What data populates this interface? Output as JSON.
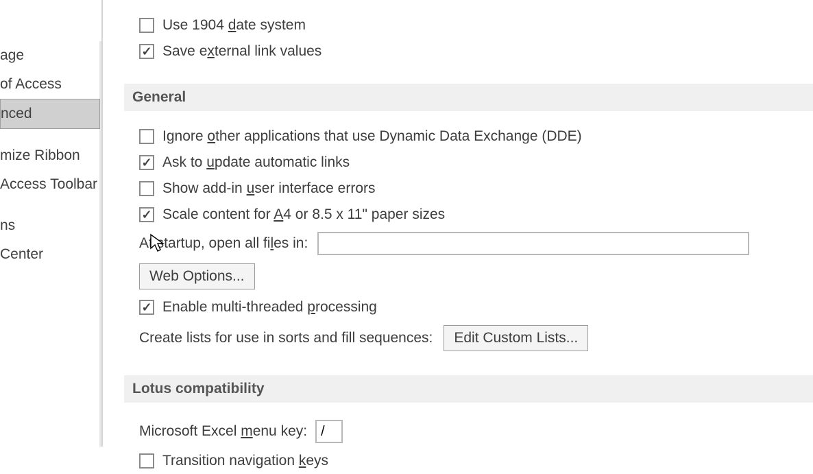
{
  "sidebar": {
    "items": [
      {
        "label": "age"
      },
      {
        "label": "of Access"
      },
      {
        "label": "nced"
      },
      {
        "label": "mize Ribbon"
      },
      {
        "label": "Access Toolbar"
      },
      {
        "label": "ns"
      },
      {
        "label": "Center"
      }
    ]
  },
  "top_options": {
    "use_1904": "Use 1904 date system",
    "save_external": "Save external link values"
  },
  "sections": {
    "general": "General",
    "lotus": "Lotus compatibility"
  },
  "general": {
    "ignore_dde": "Ignore other applications that use Dynamic Data Exchange (DDE)",
    "ask_update": "Ask to update automatic links",
    "show_addin_errors": "Show add-in user interface errors",
    "scale_a4": "Scale content for A4 or 8.5 x 11\" paper sizes",
    "startup_label": "At startup, open all files in:",
    "startup_value": "",
    "web_options": "Web Options...",
    "enable_multithread": "Enable multi-threaded processing",
    "create_lists_label": "Create lists for use in sorts and fill sequences:",
    "edit_custom_lists": "Edit Custom Lists..."
  },
  "lotus": {
    "menu_key_label": "Microsoft Excel menu key:",
    "menu_key_value": "/",
    "transition_nav": "Transition navigation keys"
  }
}
